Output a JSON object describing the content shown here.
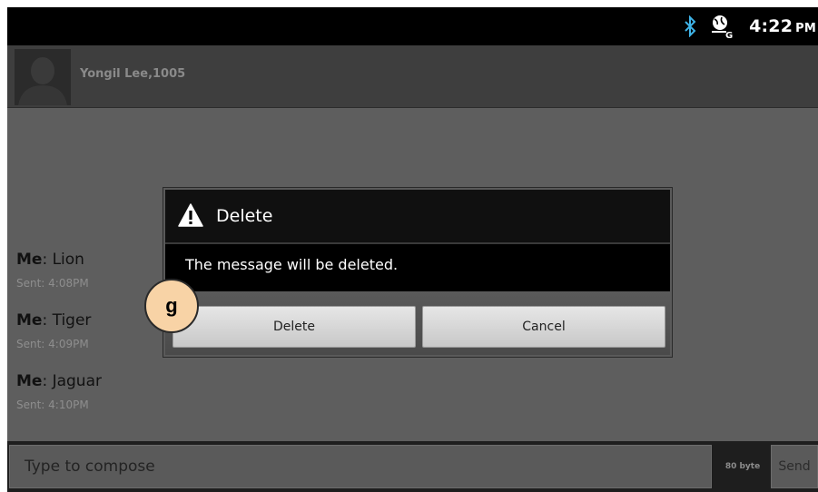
{
  "status_bar": {
    "time": "4:22",
    "ampm": "PM",
    "icons": [
      "bluetooth-icon",
      "gps-icon"
    ]
  },
  "header": {
    "contact_name": "Yongil Lee,1005",
    "avatar_icon": "person-avatar-icon"
  },
  "messages": [
    {
      "sender": "Me",
      "text": ": Lion",
      "sent": "Sent: 4:08PM"
    },
    {
      "sender": "Me",
      "text": ": Tiger",
      "sent": "Sent: 4:09PM"
    },
    {
      "sender": "Me",
      "text": ": Jaguar",
      "sent": "Sent: 4:10PM"
    }
  ],
  "compose": {
    "placeholder": "Type to compose",
    "byte_count": "80 byte",
    "send_label": "Send"
  },
  "dialog": {
    "icon": "warning-icon",
    "title": "Delete",
    "message": "The message will be deleted.",
    "delete_label": "Delete",
    "cancel_label": "Cancel"
  },
  "annotation": {
    "label": "g",
    "color": "#f8d3a6"
  }
}
